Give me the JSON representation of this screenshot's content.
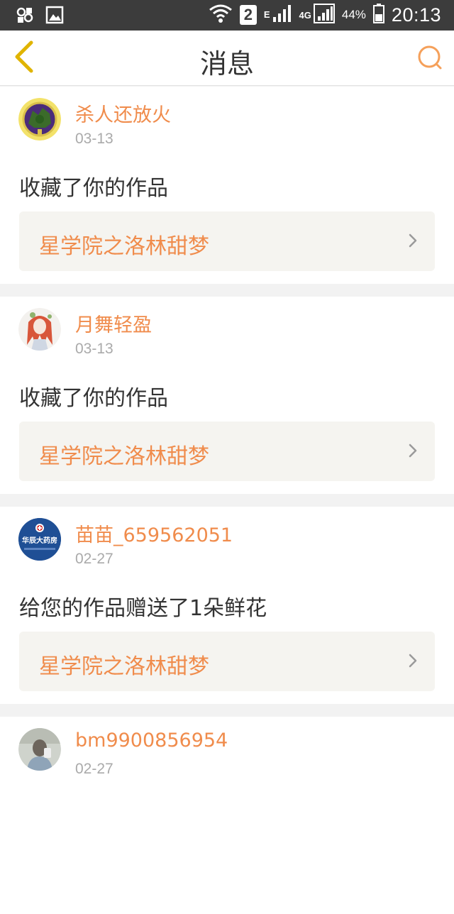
{
  "statusbar": {
    "net_type_e": "E",
    "net_type_4g": "4G",
    "sim_number": "2",
    "battery": "44%",
    "time": "20:13"
  },
  "header": {
    "title": "消息"
  },
  "colors": {
    "accent": "#f08c4c",
    "text": "#333333",
    "muted": "#aaaaaa",
    "back_icon": "#e0b400"
  },
  "messages": [
    {
      "username": "杀人还放火",
      "date": "03-13",
      "action": "收藏了你的作品",
      "work_title": "星学院之洛林甜梦",
      "avatar_icon": "avatar-emblem"
    },
    {
      "username": "月舞轻盈",
      "date": "03-13",
      "action": "收藏了你的作品",
      "work_title": "星学院之洛林甜梦",
      "avatar_icon": "avatar-anime-girl"
    },
    {
      "username": "苗苗_659562051",
      "date": "02-27",
      "action": "给您的作品赠送了1朵鲜花",
      "work_title": "星学院之洛林甜梦",
      "avatar_icon": "avatar-pharmacy-logo",
      "avatar_text": "华辰大药房"
    },
    {
      "username": "bm9900856954",
      "date": "02-27",
      "action": "",
      "work_title": "",
      "avatar_icon": "avatar-photo"
    }
  ]
}
